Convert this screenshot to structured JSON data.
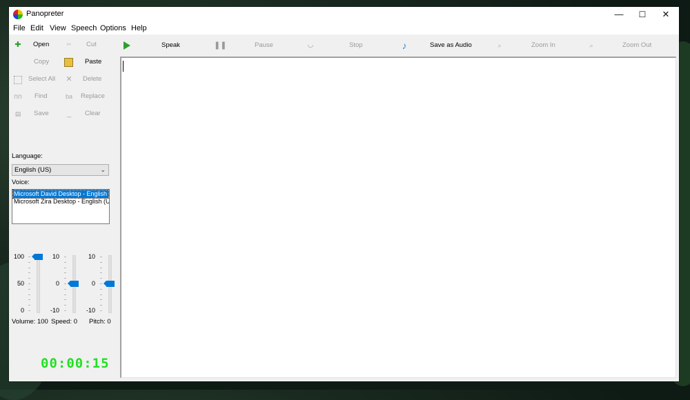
{
  "window": {
    "title": "Panopreter",
    "controls": {
      "minimize": "—",
      "maximize": "☐",
      "close": "✕"
    }
  },
  "menu": [
    "File",
    "Edit",
    "View",
    "Speech",
    "Options",
    "Help"
  ],
  "sidebar_toolbar": [
    {
      "label": "Open",
      "icon": "open-file-icon",
      "enabled": true
    },
    {
      "label": "Cut",
      "icon": "cut-icon",
      "enabled": false
    },
    {
      "label": "Copy",
      "icon": "copy-icon",
      "enabled": false
    },
    {
      "label": "Paste",
      "icon": "paste-icon",
      "enabled": true
    },
    {
      "label": "Select All",
      "icon": "select-all-icon",
      "enabled": false
    },
    {
      "label": "Delete",
      "icon": "delete-icon",
      "enabled": false
    },
    {
      "label": "Find",
      "icon": "find-icon",
      "enabled": false
    },
    {
      "label": "Replace",
      "icon": "replace-icon",
      "enabled": false
    },
    {
      "label": "Save",
      "icon": "save-icon",
      "enabled": false
    },
    {
      "label": "Clear",
      "icon": "clear-icon",
      "enabled": false
    }
  ],
  "main_toolbar": [
    {
      "label": "Speak",
      "icon": "play-icon",
      "enabled": true
    },
    {
      "label": "Pause",
      "icon": "pause-icon",
      "enabled": false
    },
    {
      "label": "Stop",
      "icon": "stop-icon",
      "enabled": false
    },
    {
      "label": "Save as Audio",
      "icon": "music-note-icon",
      "enabled": true
    },
    {
      "label": "Zoom In",
      "icon": "zoom-in-icon",
      "enabled": false
    },
    {
      "label": "Zoom Out",
      "icon": "zoom-out-icon",
      "enabled": false
    }
  ],
  "language": {
    "label": "Language:",
    "selected": "English (US)"
  },
  "voice": {
    "label": "Voice:",
    "options": [
      "Microsoft David Desktop - English (United States)",
      "Microsoft Zira Desktop - English (United States)"
    ],
    "selected_index": 0
  },
  "sliders": {
    "volume": {
      "label": "Volume: 100",
      "max_label": "100",
      "mid_label": "50",
      "min_label": "0",
      "min": 0,
      "max": 100,
      "value": 100
    },
    "speed": {
      "label": "Speed: 0",
      "max_label": "10",
      "mid_label": "0",
      "min_label": "-10",
      "min": -10,
      "max": 10,
      "value": 0
    },
    "pitch": {
      "label": "Pitch: 0",
      "max_label": "10",
      "mid_label": "0",
      "min_label": "-10",
      "min": -10,
      "max": 10,
      "value": 0
    }
  },
  "timer": "00:00:15",
  "editor": {
    "text": ""
  },
  "colors": {
    "accent": "#0078d7",
    "timer": "#21e021",
    "play": "#2e9e2e"
  }
}
